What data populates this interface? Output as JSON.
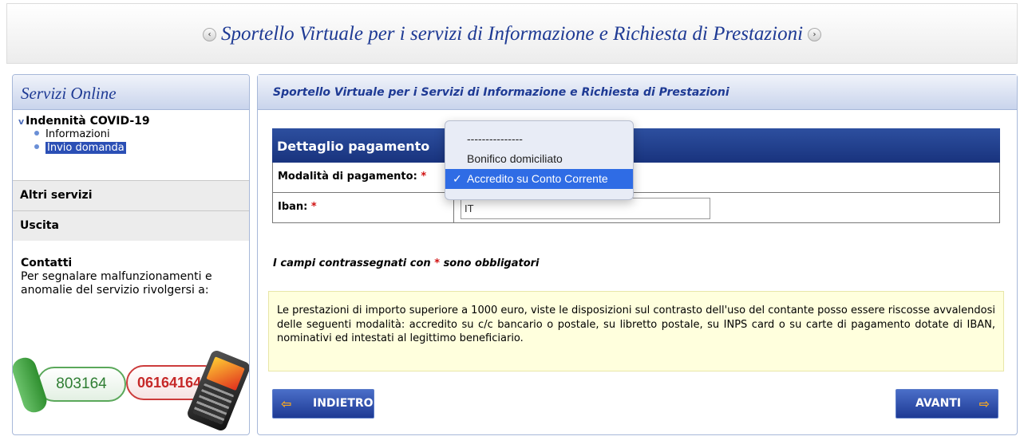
{
  "header": {
    "title": "Sportello Virtuale per i servizi di Informazione e Richiesta di Prestazioni",
    "prev_icon": "‹",
    "next_icon": "›"
  },
  "sidebar": {
    "title": "Servizi Online",
    "covid": {
      "chevron": "v",
      "title": "Indennità COVID-19",
      "items": [
        "Informazioni",
        "Invio domanda"
      ]
    },
    "items": [
      "Altri servizi",
      "Uscita"
    ],
    "contacts": {
      "title": "Contatti",
      "text": "Per segnalare malfunzionamenti e anomalie del servizio rivolgersi a:",
      "phone_green": "803164",
      "phone_red": "06164164"
    }
  },
  "main": {
    "header": "Sportello Virtuale per i Servizi di Informazione e Richiesta di Prestazioni",
    "detail_title": "Dettaglio pagamento",
    "payment_label": "Modalità di pagamento:",
    "iban_label": "Iban:",
    "required_mark": "*",
    "iban_value": "IT",
    "required_note_before": "I campi contrassegnati con",
    "required_note_after": "sono obbligatori",
    "info_text": "Le prestazioni di importo superiore a 1000 euro, viste le disposizioni sul contrasto dell'uso del contante posso essere riscosse avvalendosi delle seguenti modalità: accredito su c/c bancario o postale, su libretto postale, su INPS card o su carte di pagamento dotate di IBAN, nominativi ed intestati al legittimo beneficiario.",
    "back_label": "INDIETRO",
    "next_label": "AVANTI",
    "back_arrow": "⇦",
    "next_arrow": "⇨"
  },
  "dropdown": {
    "options": [
      "---------------",
      "Bonifico domiciliato",
      "Accredito su Conto Corrente"
    ],
    "selected": "Accredito su Conto Corrente",
    "check": "✓"
  },
  "colors": {
    "accent_blue": "#1e3a94",
    "detail_header": "#1a3580",
    "required_red": "#d01010",
    "info_bg": "#ffffdd",
    "selected_option": "#2f6ce5"
  }
}
